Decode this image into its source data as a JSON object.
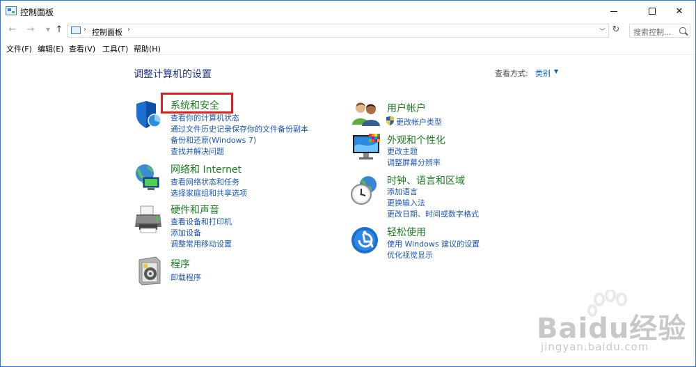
{
  "window": {
    "title": "控制面板"
  },
  "address": {
    "path": "控制面板",
    "search_placeholder": "搜索控制..."
  },
  "menu": [
    "文件(F)",
    "编辑(E)",
    "查看(V)",
    "工具(T)",
    "帮助(H)"
  ],
  "main": {
    "title": "调整计算机的设置",
    "view_by_label": "查看方式:",
    "view_by_value": "类别"
  },
  "categories_left": [
    {
      "title": "系统和安全",
      "links": [
        "查看你的计算机状态",
        "通过文件历史记录保存你的文件备份副本",
        "备份和还原(Windows 7)",
        "查找并解决问题"
      ]
    },
    {
      "title": "网络和 Internet",
      "links": [
        "查看网络状态和任务",
        "选择家庭组和共享选项"
      ]
    },
    {
      "title": "硬件和声音",
      "links": [
        "查看设备和打印机",
        "添加设备",
        "调整常用移动设置"
      ]
    },
    {
      "title": "程序",
      "links": [
        "卸载程序"
      ]
    }
  ],
  "categories_right": [
    {
      "title": "用户帐户",
      "links": [
        "更改帐户类型"
      ]
    },
    {
      "title": "外观和个性化",
      "links": [
        "更改主题",
        "调整屏幕分辨率"
      ]
    },
    {
      "title": "时钟、语言和区域",
      "links": [
        "添加语言",
        "更换输入法",
        "更改日期、时间或数字格式"
      ]
    },
    {
      "title": "轻松使用",
      "links": [
        "使用 Windows 建议的设置",
        "优化视觉显示"
      ]
    }
  ],
  "watermark": {
    "brand": "Baidu经验",
    "url": "jingyan.baidu.com"
  },
  "colors": {
    "link": "#1a56b5",
    "category_title": "#1a7b1f",
    "page_title": "#1e3287",
    "highlight": "#e02020"
  }
}
